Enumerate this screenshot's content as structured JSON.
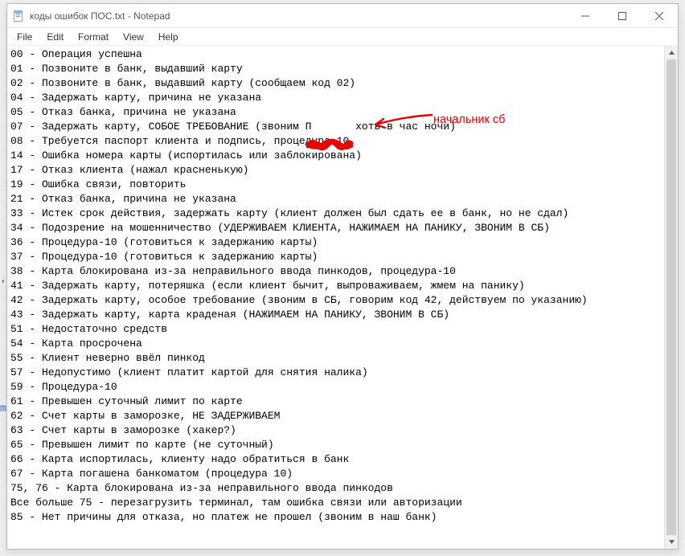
{
  "window": {
    "title": "коды ошибок ПОС.txt - Notepad"
  },
  "menu": {
    "file": "File",
    "edit": "Edit",
    "format": "Format",
    "view": "View",
    "help": "Help"
  },
  "annotation": {
    "label": "начальник сб"
  },
  "lines": [
    "00 - Операция успешна",
    "01 - Позвоните в банк, выдавший карту",
    "02 - Позвоните в банк, выдавший карту (сообщаем код 02)",
    "04 - Задержать карту, причина не указана",
    "05 - Отказ банка, причина не указана",
    "07 - Задержать карту, СОБОЕ ТРЕБОВАНИЕ (звоним П       хоть в час ночи)",
    "08 - Требуется паспорт клиента и подпись, процедура-10",
    "14 - Ошибка номера карты (испортилась или заблокирована)",
    "17 - Отказ клиента (нажал красненькую)",
    "19 - Ошибка связи, повторить",
    "21 - Отказ банка, причина не указана",
    "33 - Истек срок действия, задержать карту (клиент должен был сдать ее в банк, но не сдал)",
    "34 - Подозрение на мошенничество (УДЕРЖИВАЕМ КЛИЕНТА, НАЖИМАЕМ НА ПАНИКУ, ЗВОНИМ В СБ)",
    "36 - Процедура-10 (готовиться к задержанию карты)",
    "37 - Процедура-10 (готовиться к задержанию карты)",
    "38 - Карта блокирована из-за неправильного ввода пинкодов, процедура-10",
    "41 - Задержать карту, потеряшка (если клиент бычит, выпроваживаем, жмем на панику)",
    "42 - Задержать карту, особое требование (звоним в СБ, говорим код 42, действуем по указанию)",
    "43 - Задержать карту, карта краденая (НАЖИМАЕМ НА ПАНИКУ, ЗВОНИМ В СБ)",
    "51 - Недостаточно средств",
    "54 - Карта просрочена",
    "55 - Клиент неверно ввёл пинкод",
    "57 - Недопустимо (клиент платит картой для снятия налика)",
    "59 - Процедура-10",
    "61 - Превышен суточный лимит по карте",
    "62 - Счет карты в заморозке, НЕ ЗАДЕРЖИВАЕМ",
    "63 - Счет карты в заморозке (хакер?)",
    "65 - Превышен лимит по карте (не суточный)",
    "66 - Карта испортилась, клиенту надо обратиться в банк",
    "67 - Карта погашена банкоматом (процедура 10)",
    "75, 76 - Карта блокирована из-за неправильного ввода пинкодов",
    "Все больше 75 - перезагрузить терминал, там ошибка связи или авторизации",
    "85 - Нет причины для отказа, но платеж не прошел (звоним в наш банк)"
  ],
  "edge_artifacts": {
    "a": ",",
    "b": "m"
  }
}
